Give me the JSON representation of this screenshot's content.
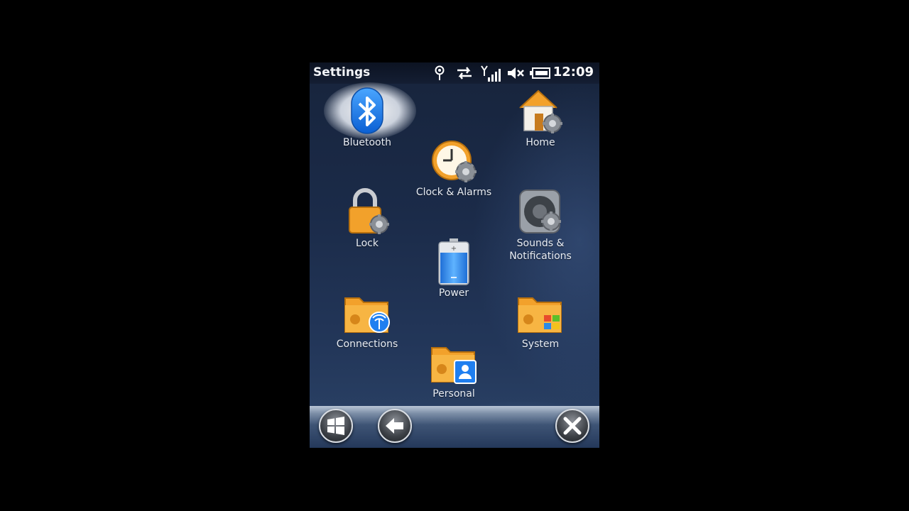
{
  "statusbar": {
    "title": "Settings",
    "time": "12:09"
  },
  "tiles": [
    {
      "id": "bluetooth",
      "label": "Bluetooth",
      "icon": "bluetooth-icon"
    },
    {
      "id": "clock",
      "label": "Clock & Alarms",
      "icon": "clock-alarm-icon"
    },
    {
      "id": "home",
      "label": "Home",
      "icon": "home-settings-icon"
    },
    {
      "id": "lock",
      "label": "Lock",
      "icon": "padlock-icon"
    },
    {
      "id": "power",
      "label": "Power",
      "icon": "battery-icon"
    },
    {
      "id": "sounds",
      "label": "Sounds &\nNotifications",
      "icon": "speaker-icon"
    },
    {
      "id": "connections",
      "label": "Connections",
      "icon": "connections-folder-icon"
    },
    {
      "id": "personal",
      "label": "Personal",
      "icon": "personal-folder-icon"
    },
    {
      "id": "system",
      "label": "System",
      "icon": "system-folder-icon"
    }
  ],
  "colors": {
    "accent_orange": "#f2a12b",
    "bluetooth_blue": "#1f7ff0",
    "background": "#1b2b49"
  },
  "taskbar": {
    "start_icon": "windows-start-icon",
    "back_icon": "back-arrow-icon",
    "close_icon": "close-icon"
  }
}
